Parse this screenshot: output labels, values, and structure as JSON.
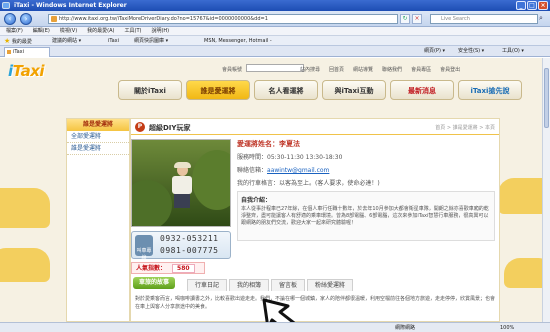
{
  "window": {
    "title": "iTaxi - Windows Internet Explorer",
    "buttons": [
      "_",
      "□",
      "×"
    ]
  },
  "address_bar": {
    "url": "http://www.itaxi.org.tw/iTaxiMoreDriverDiary.do?no=15767&id=0000000000&dd=1",
    "search_placeholder": "Live Search"
  },
  "menu": [
    "檔案(F)",
    "編輯(E)",
    "檢視(V)",
    "我的最愛(A)",
    "工具(T)",
    "說明(H)"
  ],
  "favorites": {
    "label": "我的最愛",
    "items": [
      "建議的網站 ▾",
      "iTaxi",
      "網頁快訊圖庫 ▾",
      "MSN, Messenger, Hotmail -"
    ]
  },
  "tab": {
    "label": "iTaxi",
    "commands": [
      "網頁(P) ▾",
      "安全性(S) ▾",
      "工具(O) ▾"
    ]
  },
  "site": {
    "member_label": "會員帳號",
    "top_links": [
      "站內搜尋",
      "回首頁",
      "網站導覽",
      "聯絡我們",
      "會員專區",
      "會員登出"
    ],
    "nav": [
      "關於iTaxi",
      "誰是愛運將",
      "名人看運將",
      "與iTaxi互動",
      "最新消息",
      "iTaxi搶先說"
    ],
    "left": {
      "heading": "誰是愛運將",
      "items": [
        "全部愛運將",
        "誰是愛運將"
      ]
    },
    "content": {
      "title": "超級DIY玩家",
      "breadcrumb": "首頁 > 誰是愛運將 > 本頁",
      "driver_name": "愛運將姓名：李夏法",
      "service_hours": "服務時間：05:30-11:30 13:30-18:30",
      "email_label": "聯絡信箱：",
      "email_value": "aawintw@gmail.com",
      "motto": "我的行車格言：以客為至上。(客人要求，使命必達！)",
      "intro_heading": "自我介紹：",
      "intro_text": "本人從事計程車已27年餘，在個人車行任職十數年，於去年10月參加大都會衛星車隊，開朗之餘亦喜歡車廂的乾淨整齊，盡可能讓客人有舒適的乘車環境。曾為8部電腦、6部電腦，這次來參加iTaxi智慧行車服務，很高興可以跟網路的朋友們交流，歡迎大家一起來研究體驗喔！",
      "phones": [
        "0932-053211",
        "0981-007775"
      ],
      "phone_icon_label": "叫車專線",
      "popularity_label": "人氣指數：",
      "popularity_value": "580",
      "subtabs": [
        "車旅的故事",
        "行車日記",
        "我的相簿",
        "留言板",
        "粉絲愛運將"
      ],
      "bottom_text": "對於愛乘客而言，喝咖啡讀書之外，比較喜歡出遊走走。我們，不論在哪一個城鎮，家人的陪伴都很溫暖，利用空檔前往各個地方旅遊，走走停停，欣賞風景；也會在車上與客人分享旅途中的美食。"
    }
  },
  "status": {
    "zone": "網際網路",
    "zoom": "100%"
  }
}
